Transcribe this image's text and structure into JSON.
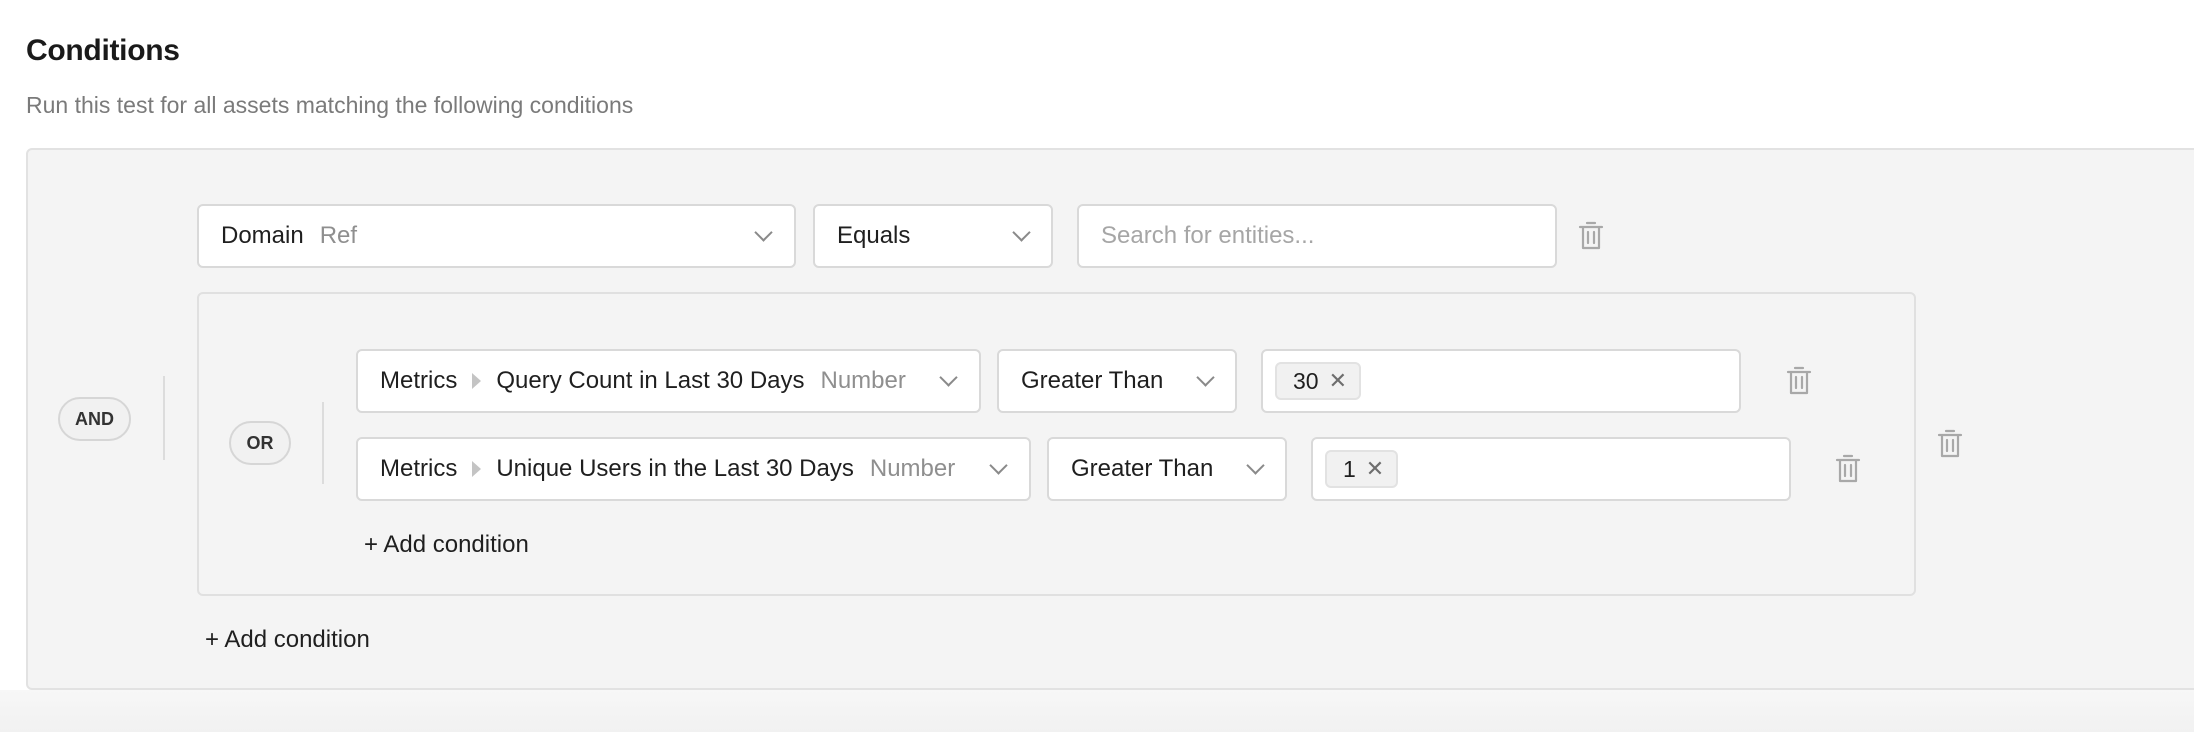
{
  "header": {
    "title": "Conditions",
    "subtitle": "Run this test for all assets matching the following conditions"
  },
  "root_group": {
    "operator": "AND",
    "conditions": [
      {
        "field": "Domain",
        "field_type": "Ref",
        "operator": "Equals",
        "value_placeholder": "Search for entities..."
      }
    ],
    "nested_group": {
      "operator": "OR",
      "conditions": [
        {
          "field_parent": "Metrics",
          "field": "Query Count in Last 30 Days",
          "field_type": "Number",
          "operator": "Greater Than",
          "values": [
            "30"
          ]
        },
        {
          "field_parent": "Metrics",
          "field": "Unique Users in the Last 30 Days",
          "field_type": "Number",
          "operator": "Greater Than",
          "values": [
            "1"
          ]
        }
      ],
      "add_condition_label": "+ Add condition"
    },
    "add_condition_label": "+ Add condition"
  },
  "icons": {
    "delete": "trash-icon",
    "dropdown": "chevron-down-icon",
    "path_separator": "caret-right-icon",
    "remove_tag": "close-icon"
  }
}
